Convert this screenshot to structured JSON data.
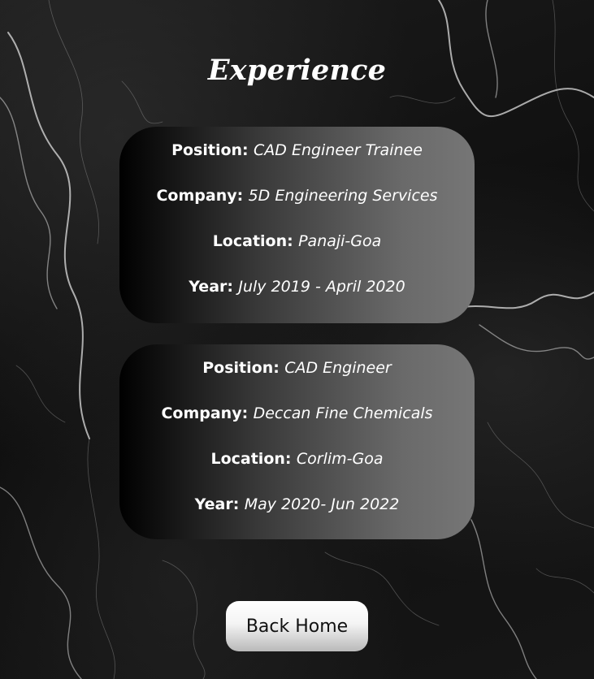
{
  "page": {
    "title": "Experience"
  },
  "experience": [
    {
      "position_label": "Position:",
      "position": "CAD Engineer Trainee",
      "company_label": "Company:",
      "company": "5D Engineering Services",
      "location_label": "Location:",
      "location": "Panaji-Goa",
      "year_label": "Year:",
      "year": "July 2019 - April 2020"
    },
    {
      "position_label": "Position:",
      "position": "CAD Engineer",
      "company_label": "Company:",
      "company": "Deccan Fine Chemicals",
      "location_label": "Location:",
      "location": "Corlim-Goa",
      "year_label": "Year:",
      "year": "May 2020- Jun 2022"
    }
  ],
  "actions": {
    "back_home_label": "Back Home"
  },
  "colors": {
    "background": "#121212",
    "text": "#ffffff",
    "card_gradient_start": "#000000",
    "card_gradient_end": "#767676",
    "button_background": "#f4f4f4",
    "button_text": "#111111"
  }
}
